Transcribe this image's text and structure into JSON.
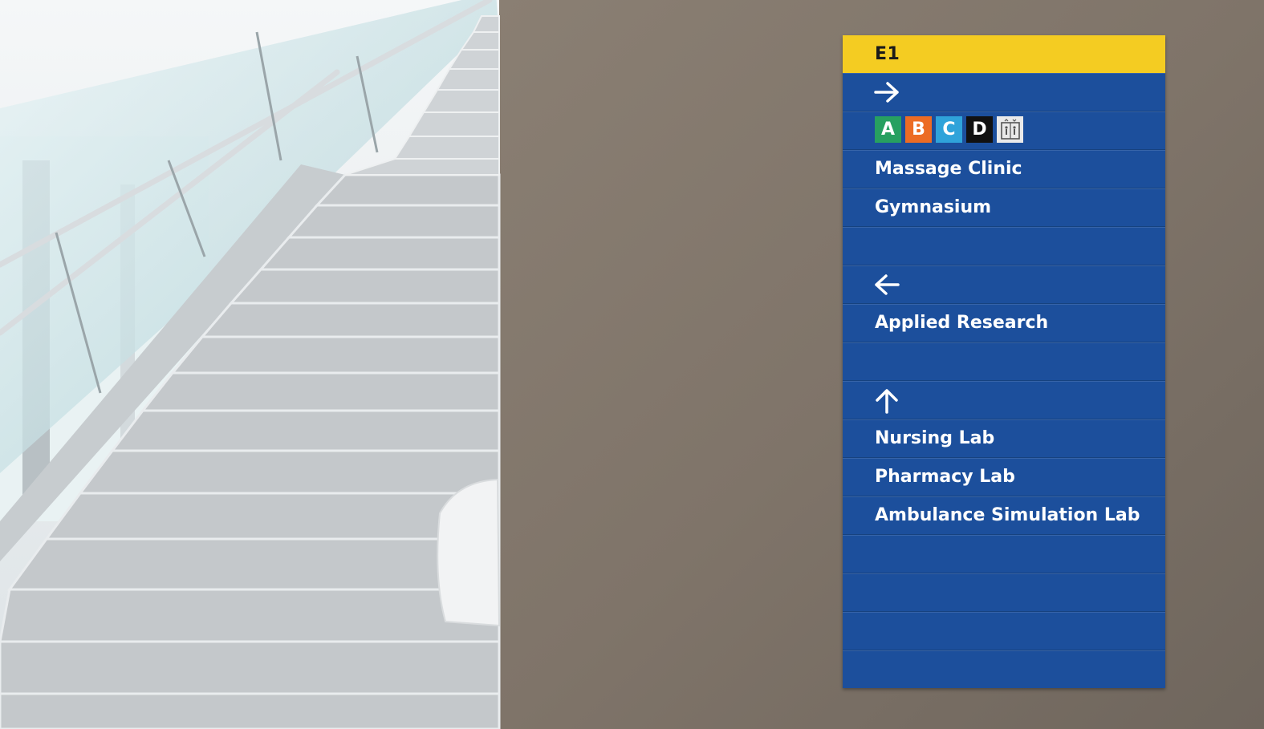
{
  "sign": {
    "code": "E1",
    "buildings": [
      {
        "letter": "A",
        "color": "#27a060"
      },
      {
        "letter": "B",
        "color": "#ec6c24"
      },
      {
        "letter": "C",
        "color": "#2fa3da"
      },
      {
        "letter": "D",
        "color": "#111111"
      }
    ],
    "elevator_icon": "elevator-icon",
    "right": {
      "arrow": "arrow-right-icon",
      "destinations": [
        "Massage Clinic",
        "Gymnasium"
      ]
    },
    "left": {
      "arrow": "arrow-left-icon",
      "destinations": [
        "Applied Research"
      ]
    },
    "up": {
      "arrow": "arrow-up-icon",
      "destinations": [
        "Nursing Lab",
        "Pharmacy Lab",
        "Ambulance Simulation Lab"
      ]
    }
  },
  "colors": {
    "sign_blue": "#1c4f9c",
    "header_yellow": "#f4cc22",
    "wall": "#83786c"
  }
}
